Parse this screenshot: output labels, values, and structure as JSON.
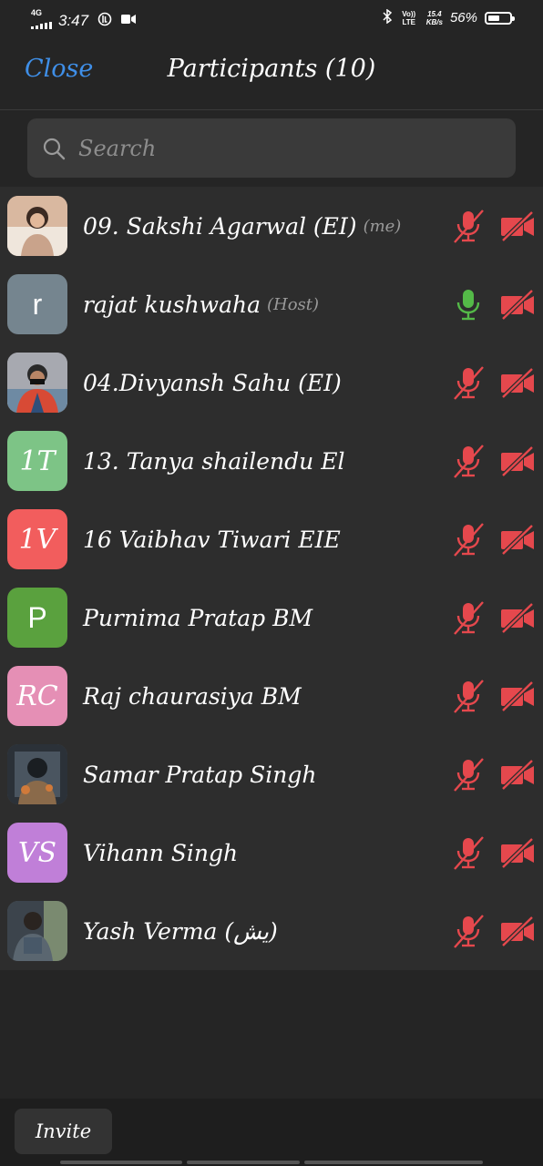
{
  "status_bar": {
    "network": "4G",
    "time": "3:47",
    "volte": "Vo)) LTE",
    "speed_value": "15.4",
    "speed_unit": "KB/s",
    "battery_percent": "56%",
    "battery_level": 0.56
  },
  "header": {
    "close_label": "Close",
    "title": "Participants (10)"
  },
  "search": {
    "placeholder": "Search"
  },
  "participants": [
    {
      "name": "09. Sakshi Agarwal (EI)",
      "tag": "(me)",
      "avatar_type": "photo",
      "avatar_text": "",
      "avatar_color": "#d9b8a0",
      "mic": "muted",
      "video": "off"
    },
    {
      "name": "rajat kushwaha",
      "tag": "(Host)",
      "avatar_type": "letter",
      "avatar_text": "r",
      "avatar_color": "#75858f",
      "mic": "on",
      "video": "off"
    },
    {
      "name": "04.Divyansh Sahu (EI)",
      "tag": "",
      "avatar_type": "photo",
      "avatar_text": "",
      "avatar_color": "#a7a9b0",
      "mic": "muted",
      "video": "off"
    },
    {
      "name": "13. Tanya shailendu El",
      "tag": "",
      "avatar_type": "initials",
      "avatar_text": "1T",
      "avatar_color": "#7dc486",
      "mic": "muted",
      "video": "off"
    },
    {
      "name": "16 Vaibhav Tiwari EIE",
      "tag": "",
      "avatar_type": "initials",
      "avatar_text": "1V",
      "avatar_color": "#f25d5d",
      "mic": "muted",
      "video": "off"
    },
    {
      "name": "Purnima Pratap BM",
      "tag": "",
      "avatar_type": "letter",
      "avatar_text": "P",
      "avatar_color": "#5aa13e",
      "mic": "muted",
      "video": "off"
    },
    {
      "name": "Raj chaurasiya BM",
      "tag": "",
      "avatar_type": "initials",
      "avatar_text": "RC",
      "avatar_color": "#e58fb5",
      "mic": "muted",
      "video": "off"
    },
    {
      "name": "Samar Pratap Singh",
      "tag": "",
      "avatar_type": "photo",
      "avatar_text": "",
      "avatar_color": "#4a5560",
      "mic": "muted",
      "video": "off"
    },
    {
      "name": "Vihann Singh",
      "tag": "",
      "avatar_type": "initials",
      "avatar_text": "VS",
      "avatar_color": "#c07fd8",
      "mic": "muted",
      "video": "off"
    },
    {
      "name": "Yash Verma (یش)",
      "tag": "",
      "avatar_type": "photo",
      "avatar_text": "",
      "avatar_color": "#5a6670",
      "mic": "muted",
      "video": "off"
    }
  ],
  "footer": {
    "invite_label": "Invite"
  },
  "colors": {
    "accent": "#3f8fe8",
    "muted_red": "#e5484d",
    "mic_on_green": "#54b948"
  },
  "icons": {
    "search": "search-icon",
    "mic_muted": "mic-off-icon",
    "mic_on": "mic-icon",
    "video_off": "video-off-icon"
  }
}
